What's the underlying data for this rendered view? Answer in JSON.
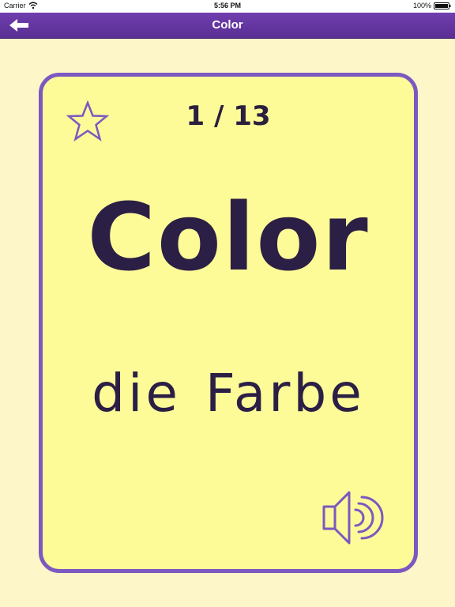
{
  "status_bar": {
    "carrier": "Carrier",
    "time": "5:56 PM",
    "battery": "100%"
  },
  "nav": {
    "title": "Color",
    "back_icon": "back-arrow-icon"
  },
  "card": {
    "counter": "1 / 13",
    "term": "Color",
    "translation": "die Farbe",
    "favorite_icon": "star-outline-icon",
    "audio_icon": "speaker-icon"
  },
  "colors": {
    "nav_purple": "#6f3fae",
    "card_border": "#7c58c0",
    "card_background": "#fdfa98",
    "page_background": "#fcf6c8",
    "text_dark": "#2b1f45"
  }
}
